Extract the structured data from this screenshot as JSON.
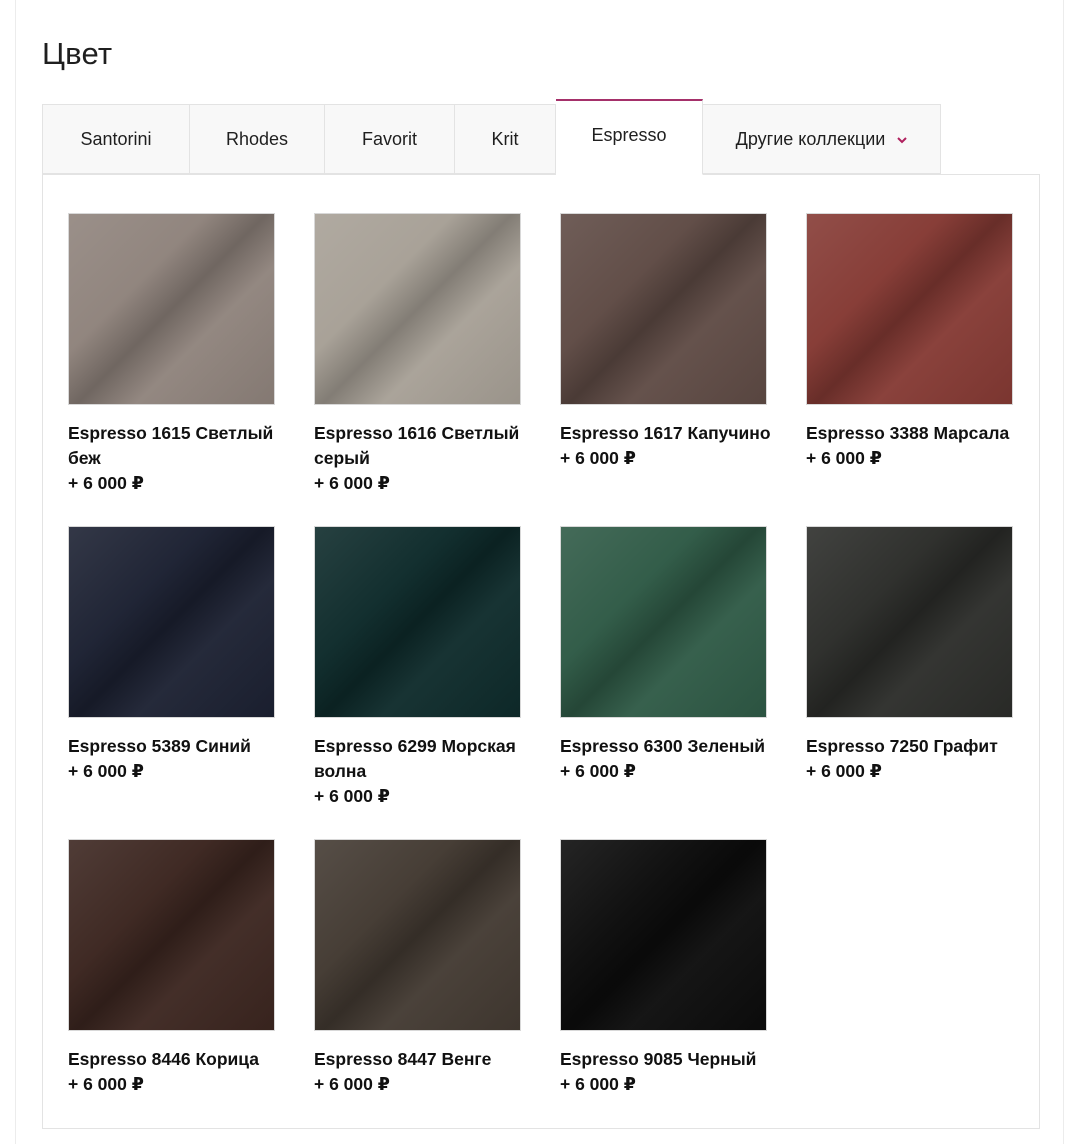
{
  "section": {
    "title": "Цвет"
  },
  "tabs": [
    {
      "label": "Santorini"
    },
    {
      "label": "Rhodes"
    },
    {
      "label": "Favorit"
    },
    {
      "label": "Krit"
    },
    {
      "label": "Espresso"
    },
    {
      "label": "Другие коллекции"
    }
  ],
  "active_tab": "Espresso",
  "accent_color": "#a5306a",
  "dropdown_icon": "chevron-down-icon",
  "swatches": [
    {
      "name": "Espresso 1615 Светлый беж",
      "price": "+ 6 000 ₽",
      "color": "#8f837c"
    },
    {
      "name": "Espresso 1616 Светлый серый",
      "price": "+ 6 000 ₽",
      "color": "#a7a096"
    },
    {
      "name": "Espresso 1617 Капучино",
      "price": "+ 6 000 ₽",
      "color": "#5f4b45"
    },
    {
      "name": "Espresso 3388 Марсала",
      "price": "+ 6 000 ₽",
      "color": "#853a34"
    },
    {
      "name": "Espresso 5389 Синий",
      "price": "+ 6 000 ₽",
      "color": "#1c2132"
    },
    {
      "name": "Espresso 6299 Морская волна",
      "price": "+ 6 000 ₽",
      "color": "#0e2b2b"
    },
    {
      "name": "Espresso 6300 Зеленый",
      "price": "+ 6 000 ₽",
      "color": "#2f5a46"
    },
    {
      "name": "Espresso 7250 Графит",
      "price": "+ 6 000 ₽",
      "color": "#2c2d2a"
    },
    {
      "name": "Espresso 8446 Корица",
      "price": "+ 6 000 ₽",
      "color": "#3c2620"
    },
    {
      "name": "Espresso 8447 Венге",
      "price": "+ 6 000 ₽",
      "color": "#433a32"
    },
    {
      "name": "Espresso 9085 Черный",
      "price": "+ 6 000 ₽",
      "color": "#0c0c0c"
    }
  ]
}
